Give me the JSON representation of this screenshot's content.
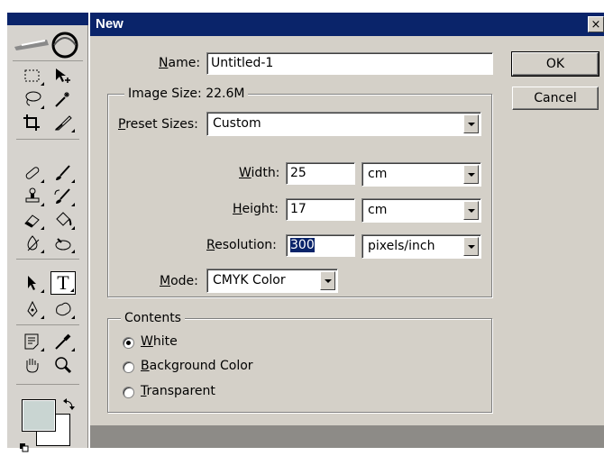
{
  "dialog": {
    "title": "New",
    "close_glyph": "×",
    "name": {
      "label": "Name:",
      "value": "Untitled-1"
    },
    "buttons": {
      "ok": "OK",
      "cancel": "Cancel"
    },
    "image_size": {
      "label": "Image Size: 22.6M"
    },
    "preset": {
      "label": "Preset Sizes:",
      "value": "Custom"
    },
    "width": {
      "label": "Width:",
      "value": "25",
      "unit": "cm"
    },
    "height": {
      "label": "Height:",
      "value": "17",
      "unit": "cm"
    },
    "resolution": {
      "label": "Resolution:",
      "value": "300",
      "unit": "pixels/inch"
    },
    "mode": {
      "label": "Mode:",
      "value": "CMYK Color"
    },
    "contents": {
      "label": "Contents",
      "options": [
        {
          "label": "White",
          "checked": true
        },
        {
          "label": "Background Color",
          "checked": false
        },
        {
          "label": "Transparent",
          "checked": false
        }
      ]
    }
  },
  "toolbox": {
    "tools": [
      "marquee-tool-icon",
      "move-tool-icon",
      "lasso-tool-icon",
      "magic-wand-tool-icon",
      "crop-tool-icon",
      "slice-tool-icon",
      "healing-brush-tool-icon",
      "brush-tool-icon",
      "clone-stamp-tool-icon",
      "history-brush-tool-icon",
      "eraser-tool-icon",
      "paint-bucket-tool-icon",
      "blur-tool-icon",
      "dodge-tool-icon",
      "path-selection-tool-icon",
      "type-tool-icon",
      "pen-tool-icon",
      "custom-shape-tool-icon",
      "notes-tool-icon",
      "eyedropper-tool-icon",
      "hand-tool-icon",
      "zoom-tool-icon"
    ],
    "active_tool": "type-tool-icon",
    "type_tool_glyph": "T",
    "foreground_color": "#c9d5d2",
    "background_color": "#ffffff"
  }
}
